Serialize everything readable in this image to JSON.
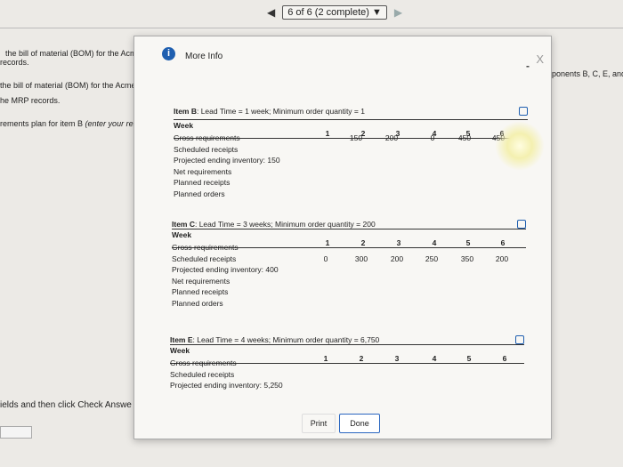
{
  "nav": {
    "progress": "6 of 6 (2 complete)",
    "prev_icon": "◀",
    "next_icon": "▶",
    "dropdown_icon": "▼"
  },
  "background": {
    "line1": "the bill of material (BOM) for the Acme P",
    "line2": "records.",
    "line3": "the bill of material (BOM) for the Acme P",
    "line4": "he MRP records.",
    "line5_pre": "rements plan for item B ",
    "line5_it": "(enter your resp",
    "right_text": "ponents B, C, E, and",
    "bottom_text": "ields and then click Check Answe"
  },
  "modal": {
    "title": "More Info",
    "minimize": "-",
    "close": "X",
    "items": [
      {
        "title_bold": "Item B",
        "title_rest": ": Lead Time = 1 week; Minimum order quantity = 1",
        "week_label": "Week",
        "weeks": [
          "1",
          "2",
          "3",
          "4",
          "5",
          "6"
        ],
        "rows": [
          {
            "label": "Gross requirements",
            "values": [
              "",
              "150",
              "200",
              "0",
              "450",
              "450"
            ]
          },
          {
            "label": "Scheduled receipts",
            "values": [
              "",
              "",
              "",
              "",
              "",
              ""
            ]
          },
          {
            "label": "Projected ending inventory: 150",
            "values": [
              "",
              "",
              "",
              "",
              "",
              ""
            ]
          },
          {
            "label": "Net requirements",
            "values": [
              "",
              "",
              "",
              "",
              "",
              ""
            ]
          },
          {
            "label": "Planned receipts",
            "values": [
              "",
              "",
              "",
              "",
              "",
              ""
            ]
          },
          {
            "label": "Planned orders",
            "values": [
              "",
              "",
              "",
              "",
              "",
              ""
            ]
          }
        ]
      },
      {
        "title_bold": "Item C",
        "title_rest": ": Lead Time = 3 weeks; Minimum order quantity = 200",
        "week_label": "Week",
        "weeks": [
          "1",
          "2",
          "3",
          "4",
          "5",
          "6"
        ],
        "rows": [
          {
            "label": "Gross requirements",
            "values": [
              "",
              "",
              "",
              "",
              "",
              ""
            ]
          },
          {
            "label": "Scheduled receipts",
            "values": [
              "0",
              "300",
              "200",
              "250",
              "350",
              "200"
            ]
          },
          {
            "label": "Projected ending inventory: 400",
            "values": [
              "",
              "",
              "",
              "",
              "",
              ""
            ]
          },
          {
            "label": "Net requirements",
            "values": [
              "",
              "",
              "",
              "",
              "",
              ""
            ]
          },
          {
            "label": "Planned receipts",
            "values": [
              "",
              "",
              "",
              "",
              "",
              ""
            ]
          },
          {
            "label": "Planned orders",
            "values": [
              "",
              "",
              "",
              "",
              "",
              ""
            ]
          }
        ]
      },
      {
        "title_bold": "Item E",
        "title_rest": ": Lead Time = 4 weeks; Minimum order quantity = 6,750",
        "week_label": "Week",
        "weeks": [
          "1",
          "2",
          "3",
          "4",
          "5",
          "6"
        ],
        "rows": [
          {
            "label": "Gross requirements",
            "values": [
              "",
              "",
              "",
              "",
              "",
              ""
            ]
          },
          {
            "label": "Scheduled receipts",
            "values": [
              "",
              "",
              "",
              "",
              "",
              ""
            ]
          },
          {
            "label": "Projected ending inventory: 5,250",
            "values": [
              "",
              "",
              "",
              "",
              "",
              ""
            ]
          }
        ]
      }
    ],
    "print_label": "Print",
    "done_label": "Done"
  }
}
